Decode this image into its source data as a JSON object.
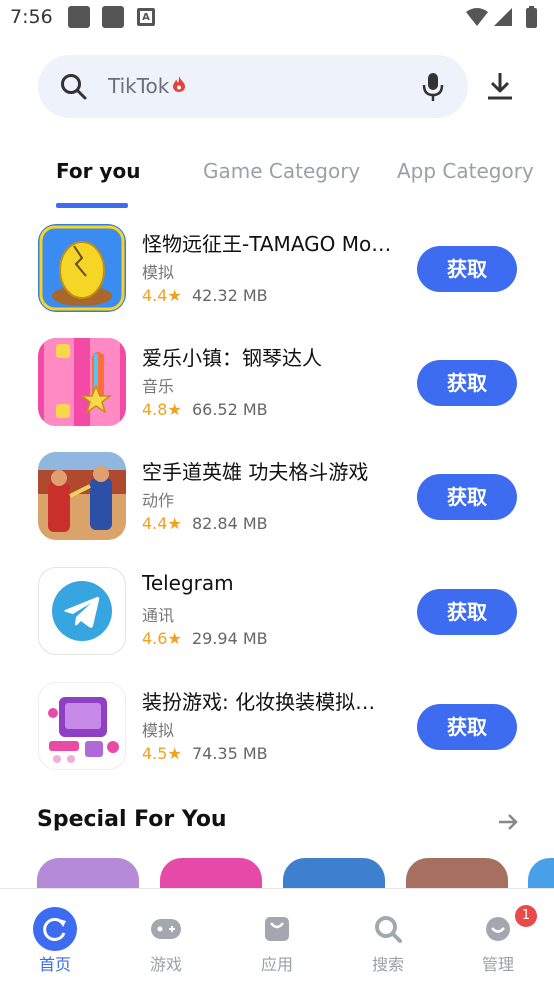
{
  "status_bar": {
    "time": "7:56",
    "notif_icons": [
      "square-icon",
      "square-icon",
      "a-icon"
    ],
    "right_icons": [
      "wifi-icon",
      "signal-icon",
      "battery-icon"
    ]
  },
  "search": {
    "placeholder": "TikTok",
    "hot_icon": "fire-icon",
    "mic_icon": "mic-icon",
    "search_icon": "search-icon"
  },
  "download_icon": "download-icon",
  "tabs": [
    {
      "label": "For you",
      "active": true
    },
    {
      "label": "Game Category",
      "active": false
    },
    {
      "label": "App Category",
      "active": false
    }
  ],
  "apps": [
    {
      "name": "怪物远征王-TAMAGO Mo…",
      "category": "模拟",
      "rating": "4.4★",
      "size": "42.32 MB",
      "button": "获取"
    },
    {
      "name": "爱乐小镇：钢琴达人",
      "category": "音乐",
      "rating": "4.8★",
      "size": "66.52 MB",
      "button": "获取"
    },
    {
      "name": "空手道英雄 功夫格斗游戏",
      "category": "动作",
      "rating": "4.4★",
      "size": "82.84 MB",
      "button": "获取"
    },
    {
      "name": "Telegram",
      "category": "通讯",
      "rating": "4.6★",
      "size": "29.94 MB",
      "button": "获取"
    },
    {
      "name": "装扮游戏: 化妆换装模拟…",
      "category": "模拟",
      "rating": "4.5★",
      "size": "74.35 MB",
      "button": "获取"
    }
  ],
  "special": {
    "title": "Special For You",
    "arrow_icon": "arrow-right-icon"
  },
  "bottom_nav": [
    {
      "label": "首页",
      "icon": "refresh-icon",
      "active": true
    },
    {
      "label": "游戏",
      "icon": "gamepad-icon",
      "active": false
    },
    {
      "label": "应用",
      "icon": "bag-icon",
      "active": false
    },
    {
      "label": "搜索",
      "icon": "search-icon",
      "active": false
    },
    {
      "label": "管理",
      "icon": "smile-icon",
      "active": false
    }
  ],
  "manage_badge": "1",
  "colors": {
    "accent": "#3d6cf0",
    "rating": "#f0a21e",
    "badge": "#e94a4a"
  }
}
